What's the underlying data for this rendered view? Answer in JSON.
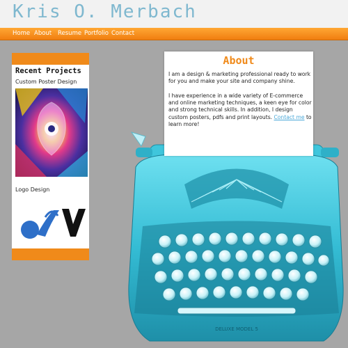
{
  "site": {
    "title": "Kris O. Merbach"
  },
  "nav": {
    "items": [
      "Home",
      "About",
      "Resume",
      "Portfolio",
      "Contact"
    ]
  },
  "sidebar": {
    "heading": "Recent Projects",
    "projects": [
      {
        "label": "Custom Poster Design"
      },
      {
        "label": "Logo Design"
      }
    ]
  },
  "about": {
    "title": "About",
    "p1": "I am a design & marketing professional ready to work for you and make your site and company shine.",
    "p2_before": "I have experience in a wide variety of E-commerce and online marketing techniques, a keen eye for color and strong technical skills. In addition, I design custom posters, pdfs and print layouts.",
    "p2_link": "Contact me",
    "p2_after": "to learn more!"
  },
  "typewriter": {
    "brand": "DELUXE MODEL 5"
  },
  "colors": {
    "accent": "#f08a1a",
    "title": "#7fb8cf",
    "typewriter": "#3cc8de",
    "background": "#a6a6a6"
  }
}
